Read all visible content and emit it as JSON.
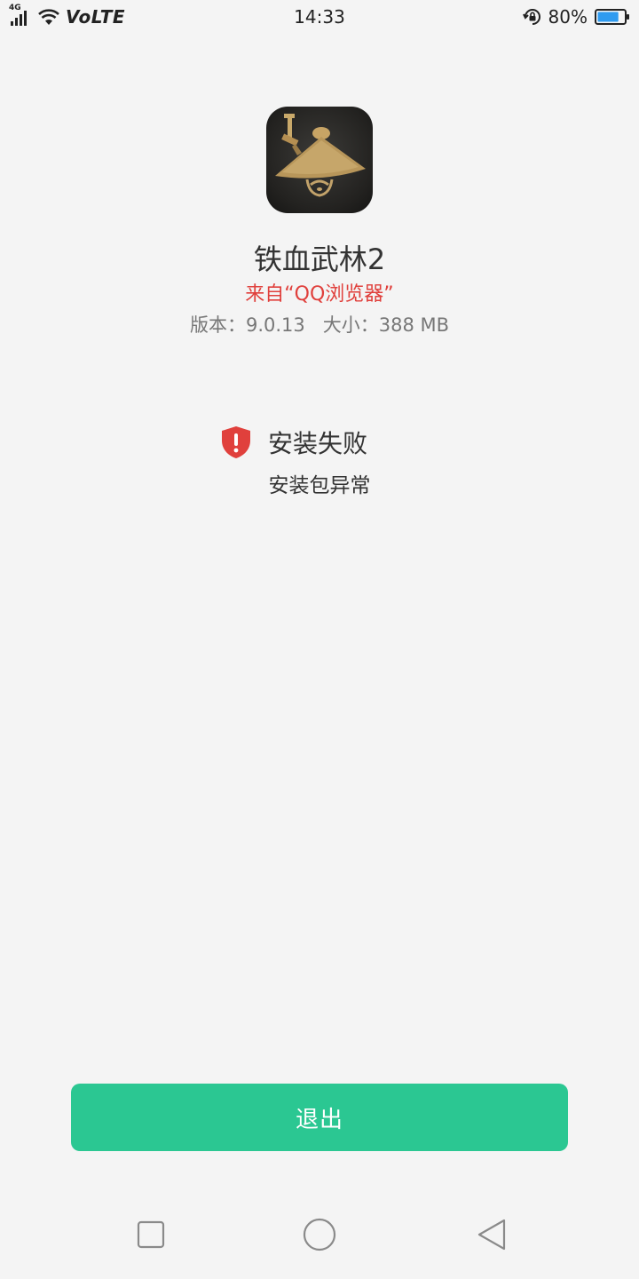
{
  "status_bar": {
    "network_type": "4G",
    "volte": "VoLTE",
    "time": "14:33",
    "battery_percent": "80%",
    "battery_level": 0.8,
    "icons": [
      "signal-icon",
      "wifi-icon",
      "rotation-lock-icon",
      "battery-icon"
    ]
  },
  "app": {
    "icon": "app-icon-bamboo-hat",
    "name": "铁血武林2",
    "source": "来自“QQ浏览器”",
    "version": "版本：9.0.13",
    "size": "大小：388 MB"
  },
  "result": {
    "icon": "shield-warning-icon",
    "title": "安装失败",
    "detail": "安装包异常"
  },
  "actions": {
    "exit_label": "退出"
  },
  "nav_bar": {
    "icons": [
      "recents-icon",
      "home-icon",
      "back-icon"
    ]
  },
  "colors": {
    "background": "#f4f4f4",
    "accent_green": "#2bc792",
    "source_red": "#e0403c",
    "error_red": "#e0403c",
    "text_primary": "#333333",
    "text_secondary": "#777777"
  }
}
